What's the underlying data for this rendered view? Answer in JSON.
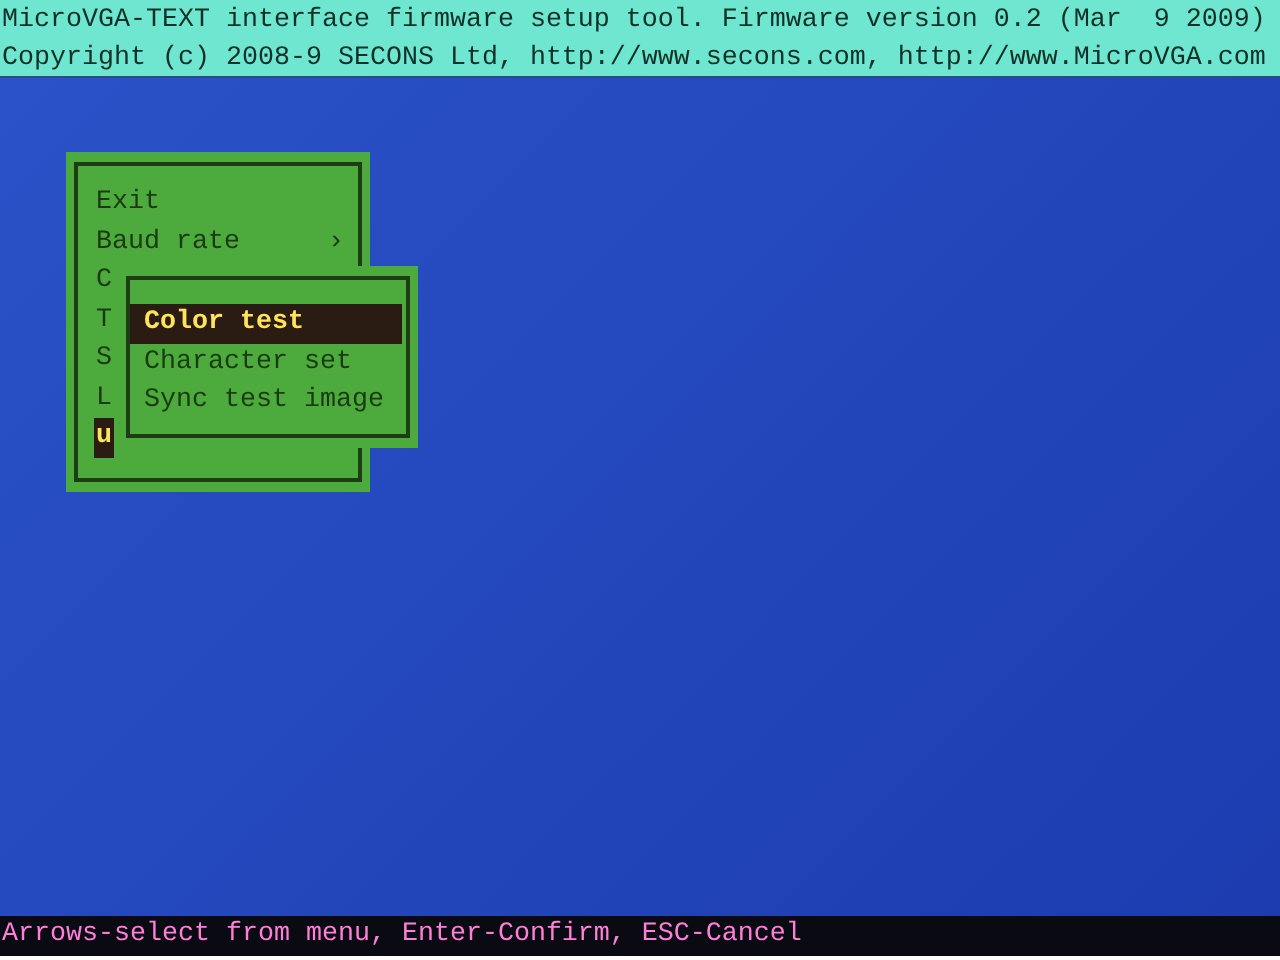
{
  "header": {
    "lines": [
      "MicroVGA-TEXT interface firmware setup tool. Firmware version 0.2 (Mar  9 2009)",
      "Copyright (c) 2008-9 SECONS Ltd, http://www.secons.com, http://www.MicroVGA.com"
    ]
  },
  "main_menu": {
    "items": [
      {
        "label": "Exit",
        "selected": false
      },
      {
        "label": "Baud rate",
        "arrow": "›",
        "selected": false
      },
      {
        "label": "C",
        "selected": false
      },
      {
        "label": "T",
        "selected": false
      },
      {
        "label": "S",
        "selected": false
      },
      {
        "label": "L",
        "selected": false
      },
      {
        "label": "u",
        "selected": true
      }
    ]
  },
  "submenu": {
    "items": [
      {
        "label": "Color test",
        "selected": true
      },
      {
        "label": "Character set",
        "selected": false
      },
      {
        "label": "Sync test image",
        "selected": false
      }
    ]
  },
  "status_bar": {
    "text": "Arrows-select from menu, Enter-Confirm, ESC-Cancel"
  }
}
